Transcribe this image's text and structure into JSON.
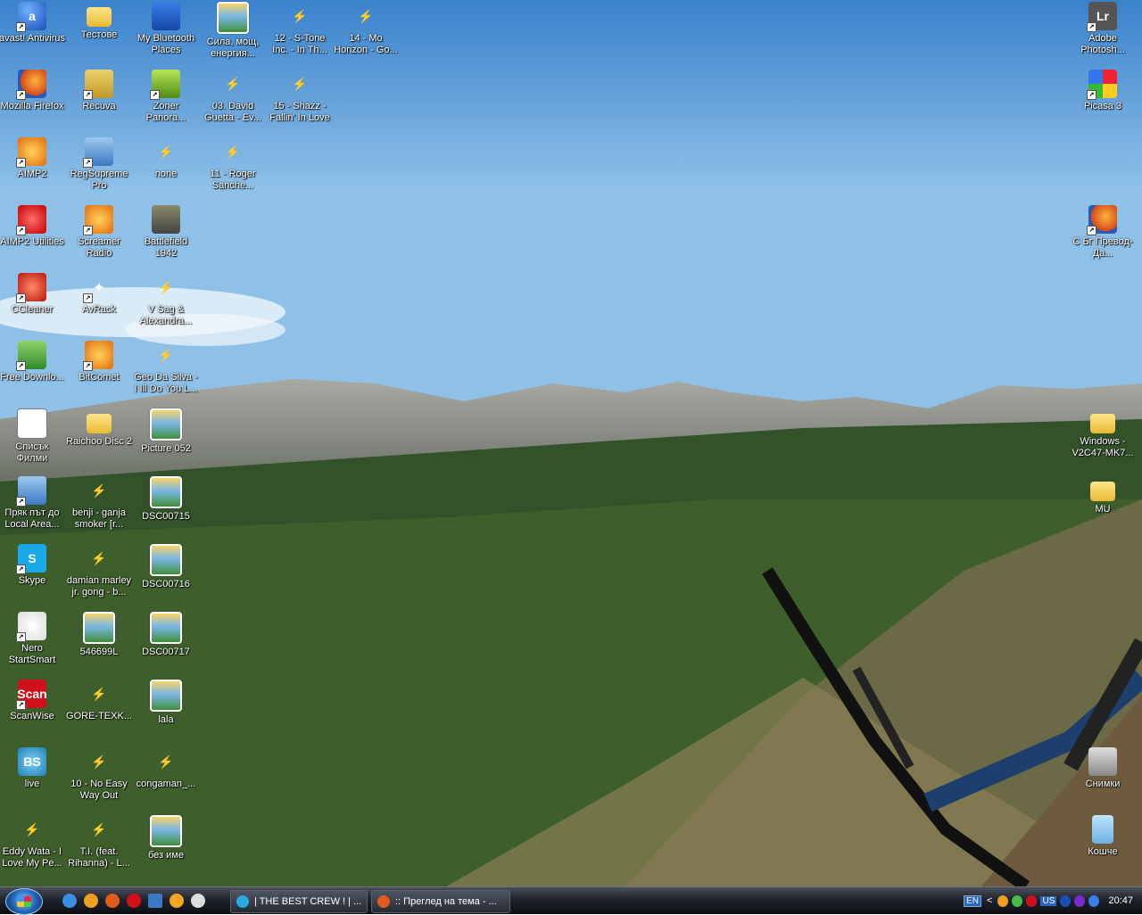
{
  "desktop": {
    "col1": [
      {
        "label": "avast! Antivirus",
        "icon": "avast-icon"
      },
      {
        "label": "Mozilla Firefox",
        "icon": "firefox-icon"
      },
      {
        "label": "AIMP2",
        "icon": "aimp2-icon"
      },
      {
        "label": "AIMP2 Utilities",
        "icon": "aimp2-utilities-icon"
      },
      {
        "label": "CCleaner",
        "icon": "ccleaner-icon"
      },
      {
        "label": "Free Downlo...",
        "icon": "free-download-manager-icon"
      },
      {
        "label": "Списък Филми",
        "icon": "word-document-icon"
      },
      {
        "label": "Пряк път до Local Area...",
        "icon": "network-connection-icon"
      },
      {
        "label": "Skype",
        "icon": "skype-icon"
      },
      {
        "label": "Nero StartSmart",
        "icon": "nero-icon"
      },
      {
        "label": "ScanWise",
        "icon": "scanwise-icon"
      },
      {
        "label": "live",
        "icon": "live-icon"
      },
      {
        "label": "Eddy Wata - I Love My Pe...",
        "icon": "winamp-media-icon"
      }
    ],
    "col2": [
      {
        "label": "Тестове",
        "icon": "folder-icon"
      },
      {
        "label": "Recuva",
        "icon": "recuva-icon"
      },
      {
        "label": "RegSupreme Pro",
        "icon": "regsupreme-icon"
      },
      {
        "label": "Screamer Radio",
        "icon": "screamer-radio-icon"
      },
      {
        "label": "AvRack",
        "icon": "avrack-icon"
      },
      {
        "label": "BitComet",
        "icon": "bitcomet-icon"
      },
      {
        "label": "Raichoo Disc 2",
        "icon": "folder-icon"
      },
      {
        "label": "benji - ganja smoker [r...",
        "icon": "winamp-media-icon"
      },
      {
        "label": "damian marley jr. gong - b...",
        "icon": "winamp-media-icon"
      },
      {
        "label": "546699L",
        "icon": "picture-icon"
      },
      {
        "label": "GORE-TEXK...",
        "icon": "winamp-media-icon"
      },
      {
        "label": "10 - No Easy Way Out",
        "icon": "winamp-media-icon"
      },
      {
        "label": "T.I. (feat. Rihanna) - L...",
        "icon": "winamp-media-icon"
      }
    ],
    "col3": [
      {
        "label": "My Bluetooth Places",
        "icon": "bluetooth-icon"
      },
      {
        "label": "Zoner Panora...",
        "icon": "zoner-icon"
      },
      {
        "label": "none",
        "icon": "winamp-media-icon"
      },
      {
        "label": "Battlefield 1942",
        "icon": "battlefield-icon"
      },
      {
        "label": "V Sag & Alexandra...",
        "icon": "winamp-media-icon"
      },
      {
        "label": "Geo Da Silva - I Ill Do You L...",
        "icon": "winamp-media-icon"
      },
      {
        "label": "Picture 052",
        "icon": "picture-icon"
      },
      {
        "label": "DSC00715",
        "icon": "picture-icon"
      },
      {
        "label": "DSC00716",
        "icon": "picture-icon"
      },
      {
        "label": "DSC00717",
        "icon": "picture-icon"
      },
      {
        "label": "lala",
        "icon": "picture-icon"
      },
      {
        "label": "congaman_...",
        "icon": "winamp-media-icon"
      },
      {
        "label": "без име",
        "icon": "picture-icon"
      }
    ],
    "col4": [
      {
        "label": "Сила, мощ, енергия...",
        "icon": "picture-icon"
      },
      {
        "label": "03. David Guetta - Ev...",
        "icon": "winamp-media-icon"
      },
      {
        "label": "11 - Roger Sanche...",
        "icon": "winamp-media-icon"
      }
    ],
    "col5": [
      {
        "label": "12 - S-Tone Inc. - In Th...",
        "icon": "winamp-media-icon"
      },
      {
        "label": "15 - Shazz - Fallin' In Love",
        "icon": "winamp-media-icon"
      }
    ],
    "col6": [
      {
        "label": "14 - Mo Horizon - Go...",
        "icon": "winamp-media-icon"
      }
    ],
    "right": [
      {
        "label": "Adobe Photosh...",
        "icon": "lightroom-icon"
      },
      {
        "label": "Picasa 3",
        "icon": "picasa-icon"
      },
      {
        "label": "С Бг Превод-Да...",
        "icon": "firefox-icon"
      },
      {
        "label": "Windows - V2C47-MK7...",
        "icon": "folder-icon"
      },
      {
        "label": "MU",
        "icon": "folder-icon"
      },
      {
        "label": "Снимки",
        "icon": "camera-icon"
      },
      {
        "label": "Кошче",
        "icon": "recycle-bin-icon"
      }
    ]
  },
  "taskbar": {
    "tasks": [
      {
        "label": "| THE BEST CREW ! | ..."
      },
      {
        "label": ":: Преглед на тема - ..."
      }
    ],
    "tray": {
      "lang": "EN",
      "kbd": "US",
      "time": "20:47",
      "arrow": "<"
    }
  }
}
